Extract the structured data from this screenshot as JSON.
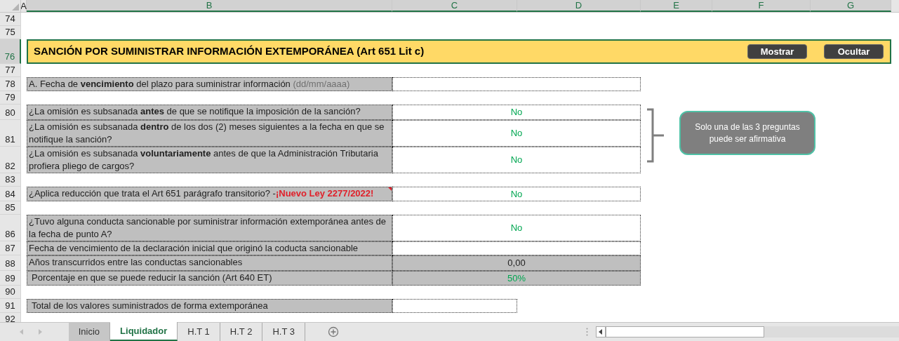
{
  "columns": [
    {
      "label": "A",
      "selected": false
    },
    {
      "label": "B",
      "selected": true
    },
    {
      "label": "C",
      "selected": true
    },
    {
      "label": "D",
      "selected": true
    },
    {
      "label": "E",
      "selected": true
    },
    {
      "label": "F",
      "selected": true
    },
    {
      "label": "G",
      "selected": true
    }
  ],
  "rows": [
    {
      "number": "74",
      "kind": "blank",
      "selected": false
    },
    {
      "number": "75",
      "kind": "blank",
      "selected": false
    },
    {
      "number": "76",
      "kind": "banner",
      "selected": true,
      "title": "SANCIÓN POR SUMINISTRAR INFORMACIÓN EXTEMPORÁNEA (Art 651 Lit c)",
      "buttons": [
        "Mostrar",
        "Ocultar"
      ]
    },
    {
      "number": "77",
      "kind": "blank",
      "selected": false
    },
    {
      "number": "78",
      "kind": "item",
      "selected": false,
      "label": "A. Fecha de **vencimiento** del plazo para suministrar información",
      "hint": "(dd/mm/aaaa)",
      "merged": true,
      "shaded": false
    },
    {
      "number": "79",
      "kind": "blank",
      "selected": false
    },
    {
      "number": "80",
      "kind": "item",
      "selected": false,
      "label": "¿La omisión es subsanada **antes** de que se notifique la imposición de la sanción?",
      "value": {
        "text": "No",
        "color": "#00a651"
      },
      "merged": true,
      "shaded": false
    },
    {
      "number": "81",
      "kind": "item",
      "selected": false,
      "label": "¿La omisión es subsanada **dentro** de los dos (2) meses siguientes a la fecha en que se notifique la sanción?",
      "value": {
        "text": "No",
        "color": "#00a651"
      },
      "merged": true,
      "shaded": false
    },
    {
      "number": "82",
      "kind": "item",
      "selected": false,
      "label": "¿La omisión es subsanada **voluntariamente** antes de que la Administración Tributaria profiera pliego de cargos?",
      "value": {
        "text": "No",
        "color": "#00a651"
      },
      "merged": true,
      "shaded": false
    },
    {
      "number": "83",
      "kind": "blank",
      "selected": false
    },
    {
      "number": "84",
      "kind": "item",
      "selected": false,
      "label": "¿Aplica reducción que trata el Art 651 parágrafo transitorio? -",
      "note": "¡Nuevo Ley 2277/2022!",
      "comment": true,
      "value": {
        "text": "No",
        "color": "#00a651"
      },
      "merged": true,
      "shaded": false
    },
    {
      "number": "85",
      "kind": "blank",
      "selected": false
    },
    {
      "number": "86",
      "kind": "item",
      "selected": false,
      "label": "¿Tuvo alguna conducta sancionable por suministrar información extemporánea antes de la fecha de punto A?",
      "value": {
        "text": "No",
        "color": "#00a651"
      },
      "merged": true,
      "shaded": false
    },
    {
      "number": "87",
      "kind": "item",
      "selected": false,
      "label": "Fecha de vencimiento de la declaración inicial que originó la coducta sancionable",
      "merged": true,
      "shaded": false
    },
    {
      "number": "88",
      "kind": "item",
      "selected": false,
      "label": "Años transcurridos entre las conductas sancionables",
      "value": {
        "text": "0,00",
        "color": "#222222"
      },
      "merged": true,
      "shaded": true
    },
    {
      "number": "89",
      "kind": "item",
      "selected": false,
      "label": "Porcentaje en que se puede reducir la sanción (Art 640 ET)",
      "indent": true,
      "value": {
        "text": "50%",
        "color": "#00a651"
      },
      "merged": true,
      "shaded": true
    },
    {
      "number": "90",
      "kind": "blank",
      "selected": false
    },
    {
      "number": "91",
      "kind": "item",
      "selected": false,
      "label": "Total de los valores suministrados de forma extemporánea",
      "indent": true,
      "merged": false,
      "shaded": false
    },
    {
      "number": "92",
      "kind": "blank",
      "selected": false
    }
  ],
  "callout": {
    "text": "Solo una de las 3 preguntas puede ser afirmativa"
  },
  "sheet_tabs": [
    {
      "label": "Inicio",
      "selected": false,
      "color": "#c6c6c6"
    },
    {
      "label": "Liquidador",
      "selected": true
    },
    {
      "label": "H.T 1",
      "selected": false
    },
    {
      "label": "H.T 2",
      "selected": false
    },
    {
      "label": "H.T 3",
      "selected": false
    }
  ]
}
